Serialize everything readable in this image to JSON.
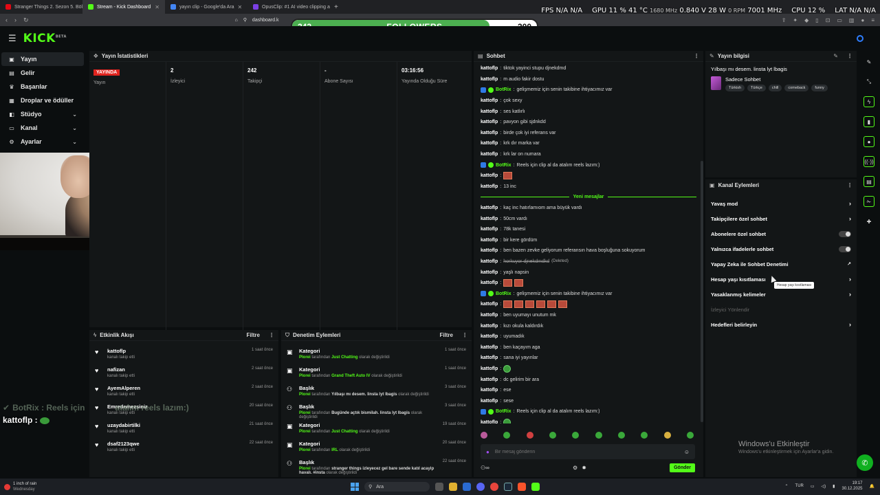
{
  "browser": {
    "tabs": [
      {
        "title": "Stranger Things 2. Sezon 5. Bölüm iz",
        "color": "#e50914",
        "active": false
      },
      {
        "title": "Stream - Kick Dashboard",
        "color": "#53fc18",
        "active": true
      },
      {
        "title": "yayın clip - Google'da Ara",
        "color": "#4285f4",
        "active": false
      },
      {
        "title": "OpusClip: #1 AI video clipping and e",
        "color": "#7b3fe4",
        "active": false
      }
    ],
    "url": "dashboard.k"
  },
  "hud": {
    "fps_label": "FPS",
    "fps_value": "N/A",
    "fps_value2": "N/A",
    "gpu_label": "GPU",
    "gpu_usage": "11 %",
    "gpu_temp": "41 °C",
    "gpu_clock": "1680 MHz",
    "gpu_volt": "0.840 V",
    "gpu_power": "28 W",
    "gpu_rpm": "0 RPM",
    "gpu_mem": "7001 MHz",
    "cpu_label": "CPU",
    "cpu_usage": "12 %",
    "lat_label": "LAT",
    "lat_value": "N/A",
    "lat_value2": "N/A"
  },
  "followers_goal": {
    "current": "242",
    "label": "FOLLOWERS",
    "goal": "300",
    "progress": 0.807
  },
  "logo": {
    "text": "KICK",
    "beta": "BETA"
  },
  "sidebar": {
    "items": [
      {
        "label": "Yayın",
        "icon": "broadcast-icon",
        "glyph": "▣",
        "active": true,
        "chevron": false
      },
      {
        "label": "Gelir",
        "icon": "revenue-icon",
        "glyph": "▤",
        "active": false,
        "chevron": false
      },
      {
        "label": "Başarılar",
        "icon": "trophy-icon",
        "glyph": "♛",
        "active": false,
        "chevron": false
      },
      {
        "label": "Droplar ve ödüller",
        "icon": "gift-icon",
        "glyph": "▦",
        "active": false,
        "chevron": false
      },
      {
        "label": "Stüdyo",
        "icon": "studio-icon",
        "glyph": "◧",
        "active": false,
        "chevron": true
      },
      {
        "label": "Kanal",
        "icon": "channel-icon",
        "glyph": "▭",
        "active": false,
        "chevron": true
      },
      {
        "label": "Ayarlar",
        "icon": "gear-icon",
        "glyph": "⚙",
        "active": false,
        "chevron": true
      }
    ]
  },
  "stream_stats": {
    "title": "Yayın İstatistikleri",
    "items": [
      {
        "value": "YAYINDA",
        "label": "Yayın",
        "live": true
      },
      {
        "value": "2",
        "label": "İzleyici",
        "live": false
      },
      {
        "value": "242",
        "label": "Takipçi",
        "live": false
      },
      {
        "value": "-",
        "label": "Abone Sayısı",
        "live": false
      },
      {
        "value": "03:16:56",
        "label": "Yayında Olduğu Süre",
        "live": false
      }
    ]
  },
  "activity": {
    "title": "Etkinlik Akışı",
    "filter": "Filtre",
    "items": [
      {
        "user": "kattoflp",
        "action": "kanalı takip etti",
        "time": "1 saat önce"
      },
      {
        "user": "nafizan",
        "action": "kanalı takip etti",
        "time": "2 saat önce"
      },
      {
        "user": "AyemAlperen",
        "action": "kanalı takip etti",
        "time": "2 saat önce"
      },
      {
        "user": "Emredemezsiniz",
        "action": "kanalı takip etti",
        "time": "20 saat önce"
      },
      {
        "user": "uzaydabirtilki",
        "action": "kanalı takip etti",
        "time": "21 saat önce"
      },
      {
        "user": "dsaf2123qwe",
        "action": "kanalı takip etti",
        "time": "22 saat önce"
      }
    ]
  },
  "moderation": {
    "title": "Denetim Eylemleri",
    "filter": "Filtre",
    "items": [
      {
        "title": "Kategori",
        "user": "Plorei",
        "mid": "tarafından",
        "value": "Just Chatting",
        "tail": "olarak değiştirildi",
        "time": "1 saat önce",
        "icon": "category-icon",
        "value_green": true
      },
      {
        "title": "Kategori",
        "user": "Plorei",
        "mid": "tarafından",
        "value": "Grand Theft Auto IV",
        "tail": "olarak değiştirildi",
        "time": "1 saat önce",
        "icon": "category-icon",
        "value_green": true
      },
      {
        "title": "Başlık",
        "user": "Plorei",
        "mid": "tarafından",
        "value": "Yılbaşı mı desem. linsta lyt lbagis",
        "tail": "olarak değiştirildi",
        "time": "3 saat önce",
        "icon": "title-icon",
        "value_green": false
      },
      {
        "title": "Başlık",
        "user": "Plorei",
        "mid": "tarafından",
        "value": "Bugünde açtık bismilah. linsta lyt lbagis",
        "tail": "olarak değiştirildi",
        "time": "3 saat önce",
        "icon": "title-icon",
        "value_green": false
      },
      {
        "title": "Kategori",
        "user": "Plorei",
        "mid": "tarafından",
        "value": "Just Chatting",
        "tail": "olarak değiştirildi",
        "time": "19 saat önce",
        "icon": "category-icon",
        "value_green": true
      },
      {
        "title": "Kategori",
        "user": "Plorei",
        "mid": "tarafından",
        "value": "IRL",
        "tail": "olarak değiştirildi",
        "time": "20 saat önce",
        "icon": "category-icon",
        "value_green": true
      },
      {
        "title": "Başlık",
        "user": "Plorei",
        "mid": "tarafından",
        "value": "stranger things izleyecez gel bare sende katıl acayip havalı. #insta",
        "tail": "olarak değiştirildi",
        "time": "22 saat önce",
        "icon": "title-icon",
        "value_green": false
      }
    ]
  },
  "overlay_chat": {
    "bot_line": "BotRix : Reels için",
    "bot_tail": "atalım reels lazım:)",
    "user_line": "kattoflp :"
  },
  "chat": {
    "title": "Sohbet",
    "new_messages_label": "Yeni mesajlar",
    "messages": [
      {
        "user": "kattoflp",
        "text": "tiktok yayinci stupu djnekdmd",
        "type": "user"
      },
      {
        "user": "kattoflp",
        "text": "m audio fakir dostu",
        "type": "user"
      },
      {
        "user": "BotRix",
        "text": "gelişmemiz için senin takibine ihtiyacımız var",
        "type": "bot"
      },
      {
        "user": "kattoflp",
        "text": "çok sexy",
        "type": "user"
      },
      {
        "user": "kattoflp",
        "text": "ses katlırlı",
        "type": "user"
      },
      {
        "user": "kattoflp",
        "text": "pavyon gibi sjdnkdd",
        "type": "user"
      },
      {
        "user": "kattoflp",
        "text": "birde çok iyi referans var",
        "type": "user"
      },
      {
        "user": "kattoflp",
        "text": "krk dır marka var",
        "type": "user"
      },
      {
        "user": "kattoflp",
        "text": "krk lar on numara",
        "type": "user"
      },
      {
        "user": "BotRix",
        "text": "Reels için clip al da atalım reels lazım:)",
        "type": "bot"
      },
      {
        "user": "kattoflp",
        "text": "",
        "type": "emote",
        "emotes": 1
      },
      {
        "user": "kattoflp",
        "text": "13 inc",
        "type": "user"
      },
      {
        "type": "divider"
      },
      {
        "user": "kattoflp",
        "text": "kaç inc hatırlamıom ama büyük vardı",
        "type": "user"
      },
      {
        "user": "kattoflp",
        "text": "50cm vardı",
        "type": "user"
      },
      {
        "user": "kattoflp",
        "text": "78k tanesi",
        "type": "user"
      },
      {
        "user": "kattoflp",
        "text": "bir kere gördüm",
        "type": "user"
      },
      {
        "user": "kattoflp",
        "text": "ben bazen zevke geliyorum referansın hava boşluğuna sokuyorum",
        "type": "user"
      },
      {
        "user": "kattoflp",
        "text": "horkuyor djnekdmdkd",
        "type": "deleted",
        "note": "(Deleted)"
      },
      {
        "user": "kattoflp",
        "text": "yaşlı napsin",
        "type": "user"
      },
      {
        "user": "kattoflp",
        "text": "",
        "type": "emote",
        "emotes": 2
      },
      {
        "user": "BotRix",
        "text": "gelişmemiz için senin takibine ihtiyacımız var",
        "type": "bot"
      },
      {
        "user": "kattoflp",
        "text": "",
        "type": "emote",
        "emotes": 6
      },
      {
        "user": "kattoflp",
        "text": "ben uyumayı unutum mk",
        "type": "user"
      },
      {
        "user": "kattoflp",
        "text": "kızı okula kaldırdık",
        "type": "user"
      },
      {
        "user": "kattoflp",
        "text": "uyumadık",
        "type": "user"
      },
      {
        "user": "kattoflp",
        "text": "ben kaçayım aga",
        "type": "user"
      },
      {
        "user": "kattoflp",
        "text": "sana iyi yayınlar",
        "type": "user"
      },
      {
        "user": "kattoflp",
        "text": "",
        "type": "emote-green",
        "emotes": 1
      },
      {
        "user": "kattoflp",
        "text": "dc gelirim bir ara",
        "type": "user"
      },
      {
        "user": "kattoflp",
        "text": "ese",
        "type": "user"
      },
      {
        "user": "kattoflp",
        "text": "sese",
        "type": "user"
      },
      {
        "user": "BotRix",
        "text": "Reels için clip al da atalım reels lazım:)",
        "type": "bot"
      },
      {
        "user": "kattoflp",
        "text": "",
        "type": "emote-green",
        "emotes": 1
      }
    ],
    "input_placeholder": "Bir mesaj gönderin",
    "send_label": "Gönder"
  },
  "broadcast_info": {
    "title": "Yayın bilgisi",
    "stream_title": "Yılbaşı mı desem. linsta lyt lbagis",
    "category": "Sadece Sohbet",
    "tags": [
      "Türkish",
      "Türkçe",
      "chill",
      "comeback",
      "funny"
    ]
  },
  "channel_actions": {
    "title": "Kanal Eylemleri",
    "items": [
      {
        "label": "Yavaş mod",
        "control": "chevron"
      },
      {
        "label": "Takipçilere özel sohbet",
        "control": "chevron"
      },
      {
        "label": "Abonelere özel sohbet",
        "control": "toggle"
      },
      {
        "label": "Yalnızca ifadelerle sohbet",
        "control": "toggle"
      },
      {
        "label": "Yapay Zeka ile Sohbet Denetimi",
        "control": "external"
      },
      {
        "label": "Hesap yaşı kısıtlaması",
        "control": "chevron"
      },
      {
        "label": "Yasaklanmış kelimeler",
        "control": "chevron"
      },
      {
        "label": "İzleyici Yönlendir",
        "control": "none",
        "disabled": true
      },
      {
        "label": "Hedefleri belirleyin",
        "control": "chevron"
      }
    ],
    "tooltip": "Hesap yaşı kısıtlaması"
  },
  "watermark": {
    "line1": "Windows'u Etkinleştir",
    "line2": "Windows'u etkinleştirmek için Ayarlar'a gidin."
  },
  "taskbar": {
    "weather_title": "1 inch of rain",
    "weather_sub": "Wednesday",
    "search_placeholder": "Ara",
    "lang": "TUR",
    "time": "19:17",
    "date": "30.12.2025"
  },
  "colors": {
    "kick_green": "#53fc18",
    "live_red": "#e0241f",
    "panel_bg": "#131617"
  }
}
